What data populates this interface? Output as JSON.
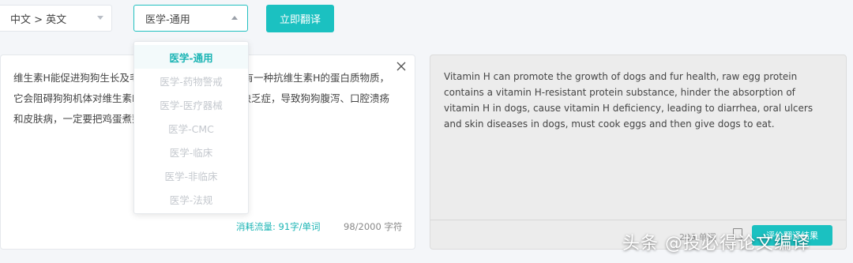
{
  "toolbar": {
    "language_pair": "中文 > 英文",
    "domain_value": "医学-通用",
    "translate_label": "立即翻译"
  },
  "domain_options": [
    {
      "label": "医学-通用",
      "selected": true
    },
    {
      "label": "医学-药物警戒",
      "selected": false
    },
    {
      "label": "医学-医疗器械",
      "selected": false
    },
    {
      "label": "医学-CMC",
      "selected": false
    },
    {
      "label": "医学-临床",
      "selected": false
    },
    {
      "label": "医学-非临床",
      "selected": false
    },
    {
      "label": "医学-法规",
      "selected": false
    }
  ],
  "source": {
    "text_visible_line1": "维生素H能促进狗狗生长及毛",
    "text_visible_line1_right": "有一种抗维生素H的蛋白质物质，",
    "text_visible_line2": "它会阻碍狗狗机体对维生素H",
    "text_visible_line2_right": "缺乏症，导致狗狗腹泻、口腔溃疡",
    "text_visible_line3": "和皮肤病，一定要把鸡蛋煮熟",
    "usage_label": "消耗流量: 91字/单词",
    "char_count": "98/2000 字符"
  },
  "target": {
    "text": "Vitamin H can promote the growth of dogs and fur health, raw egg protein contains a vitamin H-resistant protein substance, hinder the absorption of vitamin H in dogs, cause vitamin H deficiency, leading to diarrhea, oral ulcers and skin diseases in dogs, must cook eggs and then give dogs to eat.",
    "count": "206 单词",
    "rate_label": "评价翻译结果"
  },
  "watermark": "头条 @投必得论文编译",
  "colors": {
    "accent": "#1bc1c1",
    "page_bg": "#f4f6f9",
    "output_bg": "#ececec"
  }
}
